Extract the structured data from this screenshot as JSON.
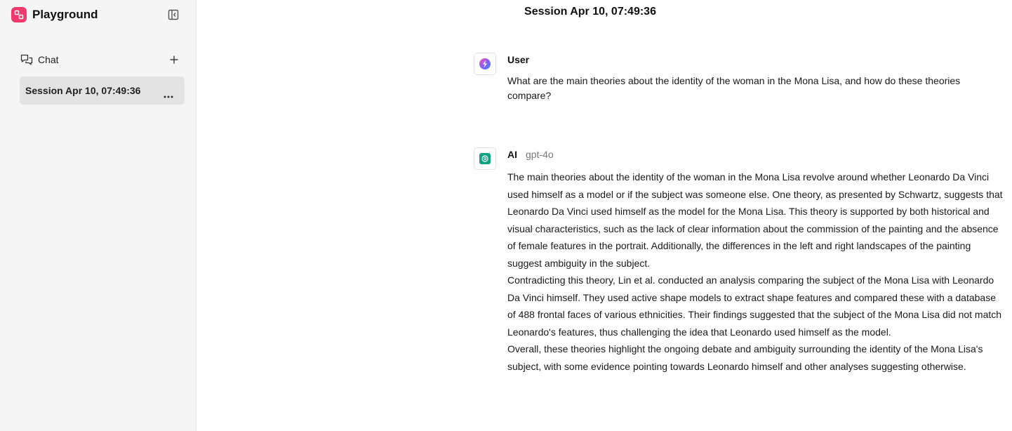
{
  "sidebar": {
    "brand_title": "Playground",
    "chat_label": "Chat",
    "sessions": [
      {
        "label": "Session Apr 10, 07:49:36",
        "active": true
      }
    ]
  },
  "main": {
    "title": "Session Apr 10, 07:49:36",
    "messages": [
      {
        "role": "User",
        "text": "What are the main theories about the identity of the woman in the Mona Lisa, and how do these theories compare?"
      },
      {
        "role": "AI",
        "model": "gpt-4o",
        "paragraphs": [
          "The main theories about the identity of the woman in the Mona Lisa revolve around whether Leonardo Da Vinci used himself as a model or if the subject was someone else. One theory, as presented by Schwartz, suggests that Leonardo Da Vinci used himself as the model for the Mona Lisa. This theory is supported by both historical and visual characteristics, such as the lack of clear information about the commission of the painting and the absence of female features in the portrait. Additionally, the differences in the left and right landscapes of the painting suggest ambiguity in the subject.",
          "Contradicting this theory, Lin et al. conducted an analysis comparing the subject of the Mona Lisa with Leonardo Da Vinci himself. They used active shape models to extract shape features and compared these with a database of 488 frontal faces of various ethnicities. Their findings suggested that the subject of the Mona Lisa did not match Leonardo's features, thus challenging the idea that Leonardo used himself as the model.",
          "Overall, these theories highlight the ongoing debate and ambiguity surrounding the identity of the Mona Lisa's subject, with some evidence pointing towards Leonardo himself and other analyses suggesting otherwise."
        ]
      }
    ]
  },
  "colors": {
    "brand": "#f0396d",
    "sidebar_bg": "#f5f5f5",
    "active_item_bg": "#e3e3e3",
    "ai_icon": "#10a37f"
  },
  "icons": {
    "brand": "playground-logo-icon",
    "collapse": "sidebar-collapse-icon",
    "chat": "chat-bubbles-icon",
    "add": "plus-icon",
    "more": "more-horizontal-icon",
    "user_avatar": "user-orb-icon",
    "ai_avatar": "openai-icon"
  }
}
